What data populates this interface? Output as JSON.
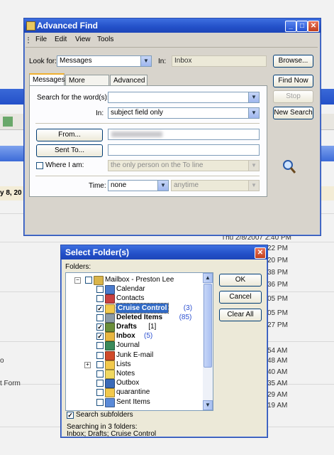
{
  "background": {
    "date_fragment": "y 8, 20",
    "timestamps": [
      "Thu 2/8/2007 2:40 PM",
      "22 PM",
      "20 PM",
      "38 PM",
      "36 PM",
      "05 PM",
      "05 PM",
      "27 PM",
      "54 AM",
      "48 AM",
      "40 AM",
      "35 AM",
      "29 AM",
      "19 AM"
    ],
    "side_fragments": [
      "o",
      "t Form"
    ]
  },
  "advanced_find": {
    "title": "Advanced Find",
    "menu": [
      "File",
      "Edit",
      "View",
      "Tools"
    ],
    "look_for_label": "Look for:",
    "look_for_value": "Messages",
    "in_label": "In:",
    "in_value": "Inbox",
    "browse_label": "Browse...",
    "find_now_label": "Find Now",
    "stop_label": "Stop",
    "new_search_label": "New Search",
    "tabs": [
      "Messages",
      "More Choices",
      "Advanced"
    ],
    "search_words_label": "Search for the word(s):",
    "search_words_value": "",
    "in_field_label": "In:",
    "in_field_value": "subject field only",
    "from_label": "From...",
    "sent_to_label": "Sent To...",
    "where_i_am_label": "Where I am:",
    "where_i_am_value": "the only person on the To line",
    "time_label": "Time:",
    "time_value": "none",
    "time_range_value": "anytime"
  },
  "select_folders": {
    "title": "Select Folder(s)",
    "folders_label": "Folders:",
    "ok_label": "OK",
    "cancel_label": "Cancel",
    "clear_all_label": "Clear All",
    "search_subfolders_label": "Search subfolders",
    "status_line1": "Searching in 3 folders:",
    "status_line2": "Inbox; Drafts; Cruise Control",
    "tree": [
      {
        "name": "Mailbox - Preston Lee",
        "count": "",
        "checked": false,
        "bold": false,
        "icon": "mailbox-icon"
      },
      {
        "name": "Calendar",
        "count": "",
        "checked": false,
        "bold": false,
        "icon": "calendar-icon"
      },
      {
        "name": "Contacts",
        "count": "",
        "checked": false,
        "bold": false,
        "icon": "contacts-icon"
      },
      {
        "name": "Cruise Control",
        "count": "(3)",
        "checked": true,
        "bold": true,
        "icon": "folder-icon"
      },
      {
        "name": "Deleted Items",
        "count": "(85)",
        "checked": false,
        "bold": true,
        "icon": "deleted-items-icon"
      },
      {
        "name": "Drafts",
        "count": "[1]",
        "checked": true,
        "bold": true,
        "icon": "drafts-icon"
      },
      {
        "name": "Inbox",
        "count": "(5)",
        "checked": true,
        "bold": true,
        "icon": "inbox-icon"
      },
      {
        "name": "Journal",
        "count": "",
        "checked": false,
        "bold": false,
        "icon": "journal-icon"
      },
      {
        "name": "Junk E-mail",
        "count": "",
        "checked": false,
        "bold": false,
        "icon": "junk-email-icon"
      },
      {
        "name": "Lists",
        "count": "",
        "checked": false,
        "bold": false,
        "icon": "folder-icon"
      },
      {
        "name": "Notes",
        "count": "",
        "checked": false,
        "bold": false,
        "icon": "notes-icon"
      },
      {
        "name": "Outbox",
        "count": "",
        "checked": false,
        "bold": false,
        "icon": "outbox-icon"
      },
      {
        "name": "quarantine",
        "count": "",
        "checked": false,
        "bold": false,
        "icon": "folder-icon"
      },
      {
        "name": "Sent Items",
        "count": "",
        "checked": false,
        "bold": false,
        "icon": "sent-items-icon"
      }
    ]
  }
}
